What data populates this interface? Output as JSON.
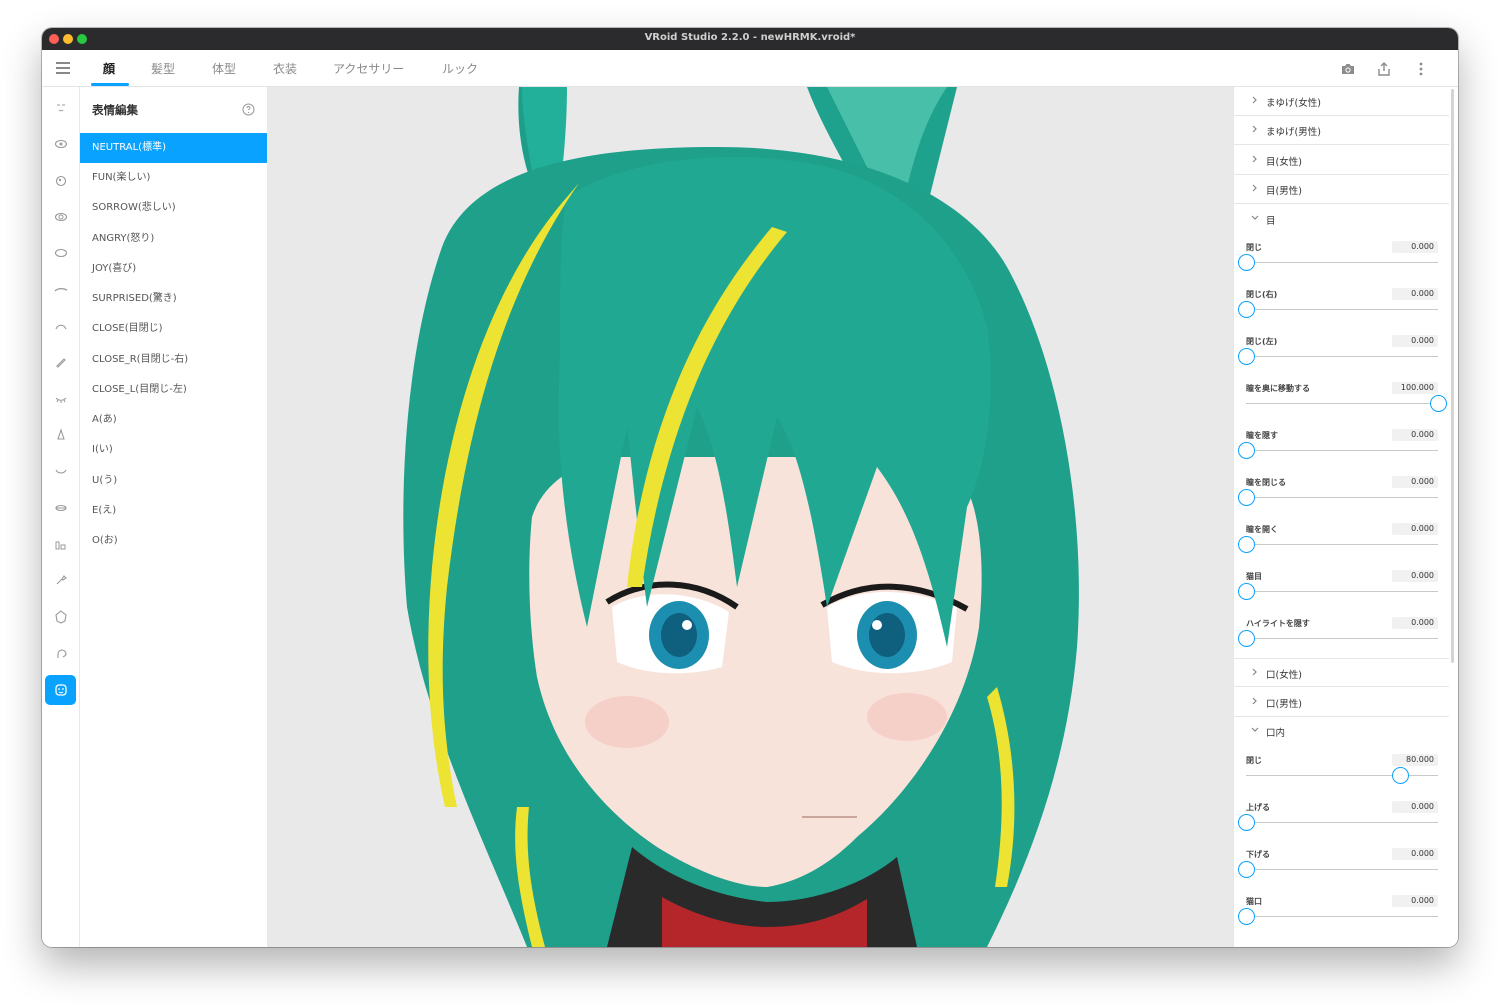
{
  "window": {
    "title": "VRoid Studio 2.2.0 - newHRMK.vroid*"
  },
  "tabs": [
    {
      "label": "顔",
      "active": true
    },
    {
      "label": "髪型",
      "active": false
    },
    {
      "label": "体型",
      "active": false
    },
    {
      "label": "衣装",
      "active": false
    },
    {
      "label": "アクセサリー",
      "active": false
    },
    {
      "label": "ルック",
      "active": false
    }
  ],
  "top_actions": [
    "camera-icon",
    "share-icon",
    "more-vertical-icon"
  ],
  "side_icons": [
    "face-outline-icon",
    "eye-icon",
    "iris-icon",
    "eye-highlight-icon",
    "eyewhite-icon",
    "eyebrow-icon",
    "eyelash-icon",
    "eyeliner-brush-icon",
    "eyelid-icon",
    "nose-icon",
    "mouth-icon",
    "tooth-icon",
    "ear-icon",
    "brush-icon",
    "face-shape-icon",
    "head-icon",
    "expression-icon"
  ],
  "accent_color": "#0aa2ff",
  "expression_panel": {
    "header": "表情編集",
    "help_icon": "help-circle-icon",
    "items": [
      "NEUTRAL(標準)",
      "FUN(楽しい)",
      "SORROW(悲しい)",
      "ANGRY(怒り)",
      "JOY(喜び)",
      "SURPRISED(驚き)",
      "CLOSE(目閉じ)",
      "CLOSE_R(目閉じ-右)",
      "CLOSE_L(目閉じ-左)",
      "A(あ)",
      "I(い)",
      "U(う)",
      "E(え)",
      "O(お)"
    ],
    "selected_index": 0
  },
  "morph_panel": {
    "collapsed_top": [
      "まゆげ(女性)",
      "まゆげ(男性)",
      "目(女性)",
      "目(男性)"
    ],
    "eye_section": {
      "label": "目",
      "sliders": [
        {
          "name": "閉じ",
          "value": "0.000",
          "fraction": 0.0
        },
        {
          "name": "閉じ(右)",
          "value": "0.000",
          "fraction": 0.0
        },
        {
          "name": "閉じ(左)",
          "value": "0.000",
          "fraction": 0.0
        },
        {
          "name": "瞳を奥に移動する",
          "value": "100.000",
          "fraction": 1.0
        },
        {
          "name": "瞳を隠す",
          "value": "0.000",
          "fraction": 0.0
        },
        {
          "name": "瞳を閉じる",
          "value": "0.000",
          "fraction": 0.0
        },
        {
          "name": "瞳を開く",
          "value": "0.000",
          "fraction": 0.0
        },
        {
          "name": "猫目",
          "value": "0.000",
          "fraction": 0.0
        },
        {
          "name": "ハイライトを隠す",
          "value": "0.000",
          "fraction": 0.0
        }
      ]
    },
    "collapsed_mid": [
      "口(女性)",
      "口(男性)"
    ],
    "mouth_section": {
      "label": "口内",
      "sliders": [
        {
          "name": "閉じ",
          "value": "80.000",
          "fraction": 0.8
        },
        {
          "name": "上げる",
          "value": "0.000",
          "fraction": 0.0
        },
        {
          "name": "下げる",
          "value": "0.000",
          "fraction": 0.0
        },
        {
          "name": "猫口",
          "value": "0.000",
          "fraction": 0.0
        }
      ]
    }
  }
}
